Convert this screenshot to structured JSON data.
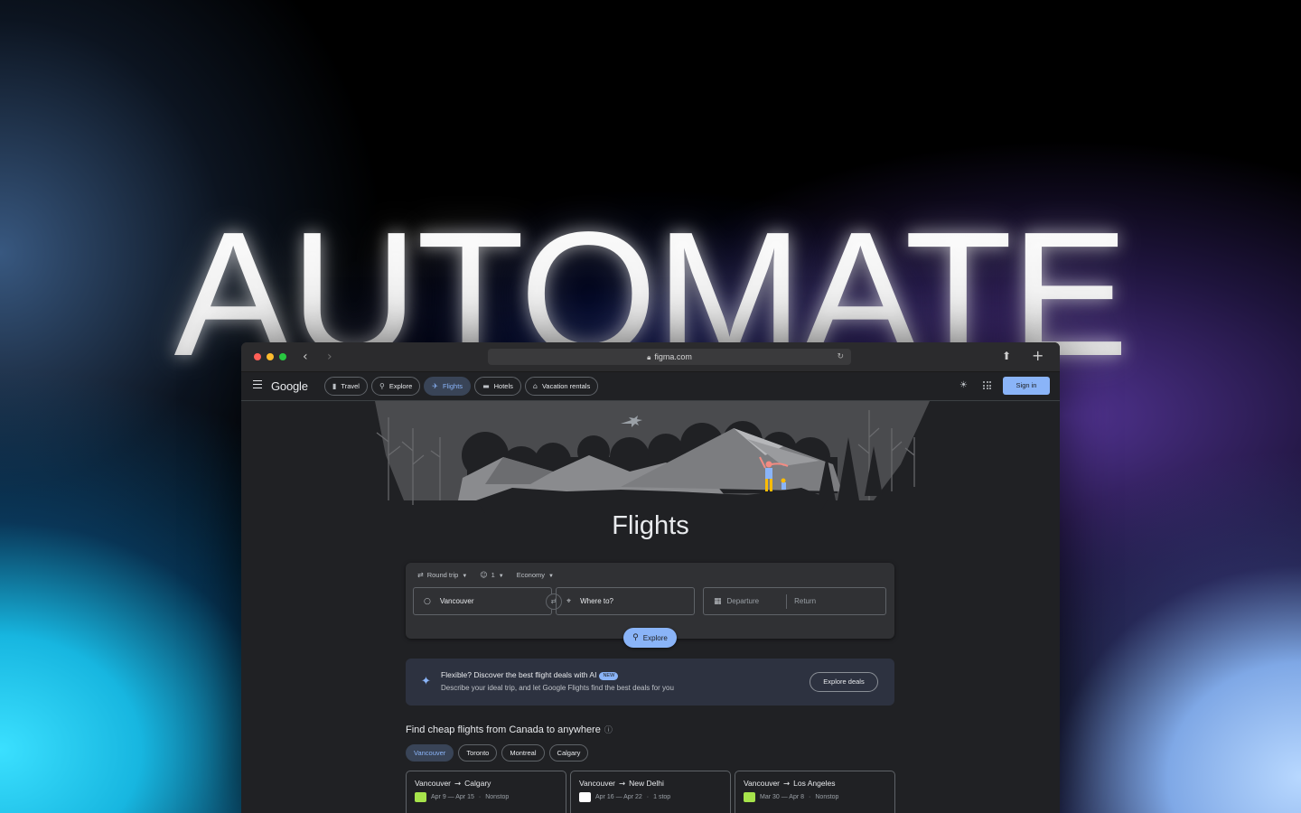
{
  "headline": "AUTOMATE",
  "browser": {
    "url": "figma.com"
  },
  "header": {
    "logo": "Google",
    "chips": [
      {
        "label": "Travel",
        "icon": "suitcase-icon"
      },
      {
        "label": "Explore",
        "icon": "explore-icon"
      },
      {
        "label": "Flights",
        "icon": "plane-icon",
        "active": true
      },
      {
        "label": "Hotels",
        "icon": "bed-icon"
      },
      {
        "label": "Vacation rentals",
        "icon": "home-icon"
      }
    ],
    "signin": "Sign in"
  },
  "hero": {
    "title": "Flights"
  },
  "search": {
    "trip_type": "Round trip",
    "passengers": "1",
    "cabin": "Economy",
    "origin": "Vancouver",
    "destination_placeholder": "Where to?",
    "departure_placeholder": "Departure",
    "return_placeholder": "Return",
    "explore_label": "Explore"
  },
  "ai_banner": {
    "title": "Flexible? Discover the best flight deals with AI",
    "badge": "NEW",
    "subtitle": "Describe your ideal trip, and let Google Flights find the best deals for you",
    "button": "Explore deals"
  },
  "cheap_flights": {
    "heading": "Find cheap flights from Canada to anywhere",
    "cities": [
      "Vancouver",
      "Toronto",
      "Montreal",
      "Calgary"
    ],
    "active_city": "Vancouver",
    "cards": [
      {
        "from": "Vancouver",
        "to": "Calgary",
        "dates": "Apr 9 — Apr 15",
        "stops": "Nonstop",
        "logo_color": "#a6e34b"
      },
      {
        "from": "Vancouver",
        "to": "New Delhi",
        "dates": "Apr 16 — Apr 22",
        "stops": "1 stop",
        "logo_color": "#ffffff"
      },
      {
        "from": "Vancouver",
        "to": "Los Angeles",
        "dates": "Mar 30 — Apr 8",
        "stops": "Nonstop",
        "logo_color": "#a6e34b"
      }
    ]
  },
  "colors": {
    "accent": "#8ab4f8",
    "surface": "#202124",
    "card": "#303134"
  }
}
